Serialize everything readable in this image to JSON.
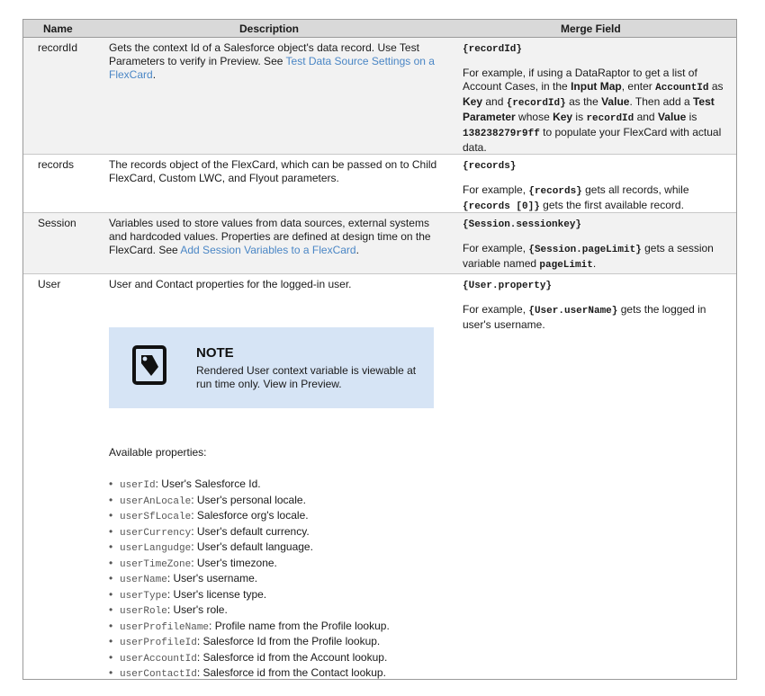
{
  "header": {
    "name": "Name",
    "description": "Description",
    "merge_field": "Merge Field"
  },
  "rows": [
    {
      "name": "recordId",
      "desc_1": "Gets the context Id of a Salesforce object's data record. Use Test Parameters to verify in Preview. See ",
      "desc_link": "Test Data Source Settings on a FlexCard",
      "desc_2": ".",
      "merge_code": "{recordId}",
      "ex": {
        "t1": "For example, if using a DataRaptor to get a list of Account Cases, in the ",
        "b1": "Input Map",
        "t2": ", enter ",
        "c1": "AccountId",
        "t3": " as ",
        "b2": "Key",
        "t4": " and ",
        "c2": "{recordId}",
        "t5": " as the ",
        "b3": "Value",
        "t6": ". Then add a ",
        "b4": "Test Parameter",
        "t7": " whose ",
        "b5": "Key",
        "t8": " is ",
        "c3": "recordId",
        "t9": " and ",
        "b6": "Value",
        "t10": " is ",
        "c4": "138238279r9ff",
        "t11": " to populate your FlexCard with actual data."
      }
    },
    {
      "name": "records",
      "desc": "The records object of the FlexCard, which can be passed on to Child FlexCard, Custom LWC, and Flyout parameters.",
      "merge_code": "{records}",
      "ex": {
        "t1": "For example, ",
        "c1": "{records}",
        "t2": " gets all records, while ",
        "c2": "{records [0]}",
        "t3": " gets the first available record."
      }
    },
    {
      "name": "Session",
      "desc_1": "Variables used to store values from data sources, external systems and hardcoded values. Properties are defined at design time on the FlexCard. See ",
      "desc_link": "Add Session Variables to a FlexCard",
      "desc_2": ".",
      "merge_code": "{Session.sessionkey}",
      "ex": {
        "t1": "For example, ",
        "c1": "{Session.pageLimit}",
        "t2": " gets a session variable named ",
        "c2": "pageLimit",
        "t3": "."
      }
    },
    {
      "name": "User",
      "desc": "User and Contact properties for the logged-in user.",
      "merge_code": "{User.property}",
      "ex": {
        "t1": "For example, ",
        "c1": "{User.userName}",
        "t2": " gets the logged in user's username."
      },
      "note": {
        "title": "NOTE",
        "text": "Rendered User context variable is viewable at run time only. View in Preview."
      },
      "available_label": "Available properties:",
      "properties": [
        {
          "key": "userId",
          "desc": ": User's Salesforce Id."
        },
        {
          "key": "userAnLocale",
          "desc": ": User's personal locale."
        },
        {
          "key": "userSfLocale",
          "desc": ": Salesforce org's locale."
        },
        {
          "key": "userCurrency",
          "desc": ": User's default currency."
        },
        {
          "key": "userLangudge",
          "desc": ": User's default language."
        },
        {
          "key": "userTimeZone",
          "desc": ": User's timezone."
        },
        {
          "key": "userName",
          "desc": ": User's username."
        },
        {
          "key": "userType",
          "desc": ": User's license type."
        },
        {
          "key": "userRole",
          "desc": ": User's role."
        },
        {
          "key": "userProfileName",
          "desc": ": Profile name from the Profile lookup."
        },
        {
          "key": "userProfileId",
          "desc": ": Salesforce Id from the Profile lookup."
        },
        {
          "key": "userAccountId",
          "desc": ": Salesforce id from the Account lookup."
        },
        {
          "key": "userContactId",
          "desc": ": Salesforce id from the Contact lookup."
        }
      ]
    }
  ],
  "colors": {
    "header_bg": "#d9d9d9",
    "shade_bg": "#f2f2f2",
    "link": "#4a86c5",
    "note_bg": "#d6e4f5"
  },
  "icons": {
    "note": "note-tag-icon"
  }
}
